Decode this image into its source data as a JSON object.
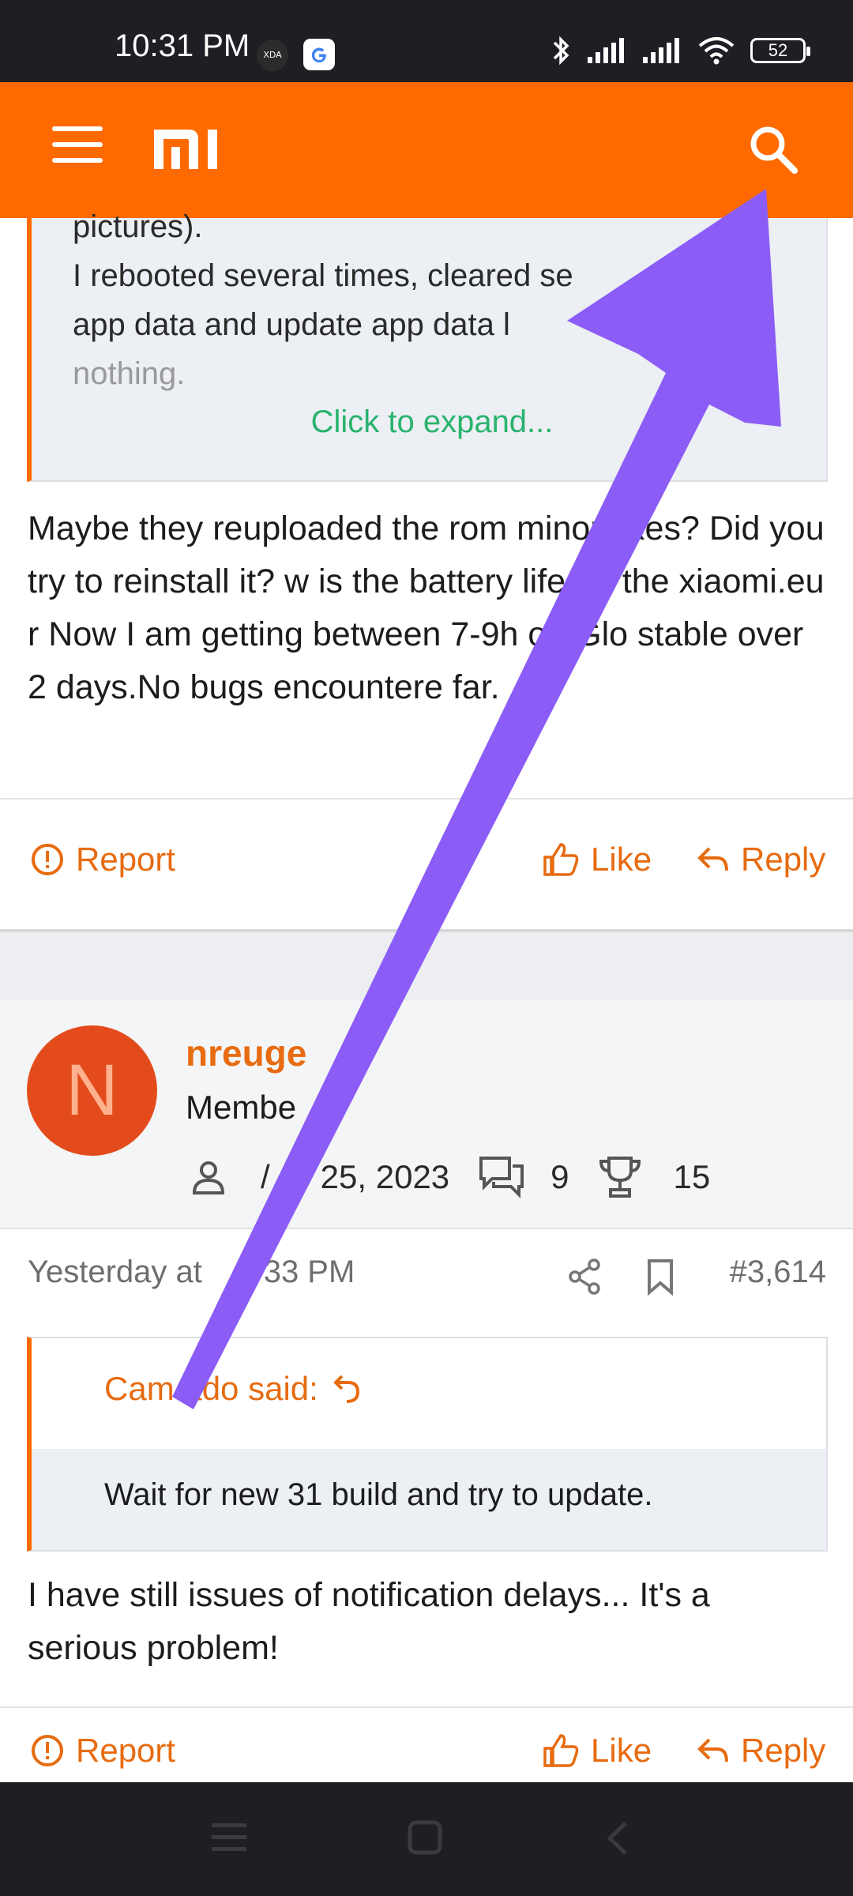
{
  "status": {
    "time": "10:31 PM",
    "xda": "XDA",
    "battery": "52"
  },
  "quote1": {
    "lines": [
      "pictures).",
      "I rebooted several times, cleared se",
      "app data and update app data l",
      "nothing."
    ],
    "expand": "Click to expand..."
  },
  "post1": {
    "body": "Maybe they reuploaded the rom minor fixes? Did you try to reinstall it? w is the battery life on the xiaomi.eu r Now I am getting between 7-9h on Glo stable over 2 days.No bugs encountere far."
  },
  "actions": {
    "report": "Report",
    "like": "Like",
    "reply": "Reply"
  },
  "user": {
    "initial": "N",
    "name": "nreuge",
    "title": "Membe",
    "joined_prefix": "/",
    "joined": "25, 2023",
    "messages": "9",
    "points": "15"
  },
  "post2_meta": {
    "date": "Yesterday at",
    "time": "33 PM",
    "number": "#3,614"
  },
  "quote2": {
    "author": "Cam ado said:",
    "text": "Wait for new 31 build and try to update."
  },
  "post2": {
    "body": "I have still issues of notification delays... It's a serious problem!"
  },
  "colors": {
    "brand": "#ff6a00",
    "link": "#e76b10",
    "expand": "#29b36e",
    "annotation_arrow": "#8b5cf6"
  }
}
